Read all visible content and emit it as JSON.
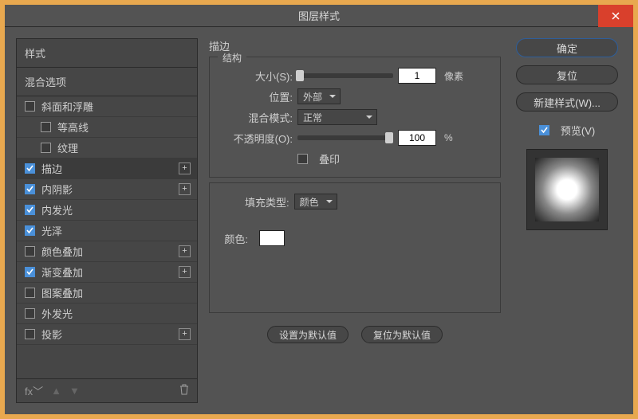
{
  "title": "图层样式",
  "sidebar": {
    "header1": "样式",
    "header2": "混合选项",
    "items": [
      {
        "label": "斜面和浮雕",
        "indent": 0,
        "checked": false,
        "plus": false
      },
      {
        "label": "等高线",
        "indent": 1,
        "checked": false,
        "plus": false
      },
      {
        "label": "纹理",
        "indent": 1,
        "checked": false,
        "plus": false
      },
      {
        "label": "描边",
        "indent": 0,
        "checked": true,
        "plus": true,
        "active": true
      },
      {
        "label": "内阴影",
        "indent": 0,
        "checked": true,
        "plus": true
      },
      {
        "label": "内发光",
        "indent": 0,
        "checked": true,
        "plus": false
      },
      {
        "label": "光泽",
        "indent": 0,
        "checked": true,
        "plus": false
      },
      {
        "label": "颜色叠加",
        "indent": 0,
        "checked": false,
        "plus": true
      },
      {
        "label": "渐变叠加",
        "indent": 0,
        "checked": true,
        "plus": true
      },
      {
        "label": "图案叠加",
        "indent": 0,
        "checked": false,
        "plus": false
      },
      {
        "label": "外发光",
        "indent": 0,
        "checked": false,
        "plus": false
      },
      {
        "label": "投影",
        "indent": 0,
        "checked": false,
        "plus": true
      }
    ]
  },
  "center": {
    "title": "描边",
    "structure_legend": "结构",
    "size_label": "大小(S):",
    "size_value": "1",
    "size_unit": "像素",
    "position_label": "位置:",
    "position_value": "外部",
    "blend_label": "混合模式:",
    "blend_value": "正常",
    "opacity_label": "不透明度(O):",
    "opacity_value": "100",
    "opacity_unit": "%",
    "overprint_label": "叠印",
    "filltype_label": "填充类型:",
    "filltype_value": "颜色",
    "color_label": "颜色:",
    "color_value": "#ffffff",
    "default_set": "设置为默认值",
    "default_reset": "复位为默认值"
  },
  "right": {
    "ok": "确定",
    "reset": "复位",
    "new_style": "新建样式(W)...",
    "preview_label": "预览(V)",
    "preview_checked": true
  }
}
